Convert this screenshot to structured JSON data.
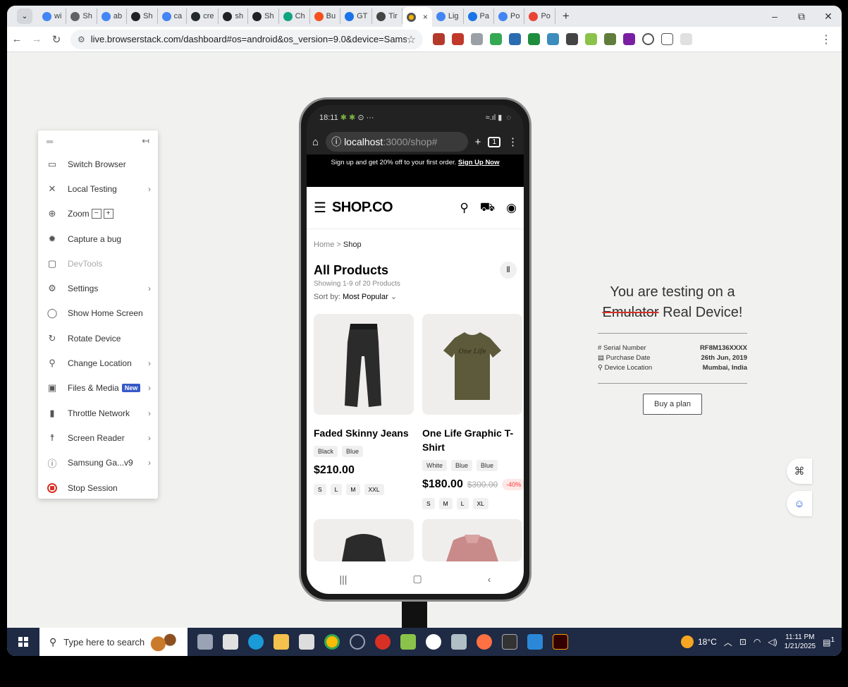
{
  "browser": {
    "tabs": [
      {
        "label": "wi",
        "icon": "google-icon",
        "color": "#4285f4"
      },
      {
        "label": "Sh",
        "icon": "chrome-icon",
        "color": "#5f6368"
      },
      {
        "label": "ab",
        "icon": "google-icon",
        "color": "#4285f4"
      },
      {
        "label": "Sh",
        "icon": "app-icon",
        "color": "#202124"
      },
      {
        "label": "ca",
        "icon": "google-icon",
        "color": "#4285f4"
      },
      {
        "label": "cre",
        "icon": "github-icon",
        "color": "#24292e"
      },
      {
        "label": "sh",
        "icon": "app-icon",
        "color": "#202124"
      },
      {
        "label": "Sh",
        "icon": "app-icon",
        "color": "#202124"
      },
      {
        "label": "Ch",
        "icon": "openai-icon",
        "color": "#10a37f"
      },
      {
        "label": "Bu",
        "icon": "bookmark-icon",
        "color": "#f4511e"
      },
      {
        "label": "GT",
        "icon": "gt-icon",
        "color": "#1a73e8"
      },
      {
        "label": "Tir",
        "icon": "tinder-icon",
        "color": "#444"
      }
    ],
    "active_tab": {
      "label": "",
      "close": "×"
    },
    "tabs_after": [
      {
        "label": "Lig",
        "icon": "google-icon",
        "color": "#4285f4"
      },
      {
        "label": "Pa",
        "icon": "gauge-icon",
        "color": "#1a73e8"
      },
      {
        "label": "Po",
        "icon": "google-icon",
        "color": "#4285f4"
      },
      {
        "label": "Po",
        "icon": "app-icon",
        "color": "#ea4335"
      }
    ],
    "new_tab": "+",
    "url": "live.browserstack.com/dashboard#os=android&os_version=9.0&device=Samsun...",
    "zoom_label": "≡"
  },
  "panel": {
    "items": [
      {
        "label": "Switch Browser",
        "icon": "switch-browser-icon",
        "glyph": "▭",
        "chevron": false
      },
      {
        "label": "Local Testing",
        "icon": "local-testing-icon",
        "glyph": "✕",
        "chevron": true
      },
      {
        "label": "Zoom",
        "icon": "zoom-icon",
        "glyph": "⊕",
        "chevron": false
      },
      {
        "label": "Capture a bug",
        "icon": "bug-icon",
        "glyph": "✹",
        "chevron": false
      },
      {
        "label": "DevTools",
        "icon": "devtools-icon",
        "glyph": "▢",
        "chevron": false
      },
      {
        "label": "Settings",
        "icon": "settings-icon",
        "glyph": "⚙",
        "chevron": true
      },
      {
        "label": "Show Home Screen",
        "icon": "home-screen-icon",
        "glyph": "◯",
        "chevron": false
      },
      {
        "label": "Rotate Device",
        "icon": "rotate-icon",
        "glyph": "↻",
        "chevron": false
      },
      {
        "label": "Change Location",
        "icon": "location-icon",
        "glyph": "⚲",
        "chevron": true
      },
      {
        "label": "Files & Media",
        "icon": "files-media-icon",
        "glyph": "▣",
        "chevron": true
      },
      {
        "label": "Throttle Network",
        "icon": "network-icon",
        "glyph": "▮",
        "chevron": true
      },
      {
        "label": "Screen Reader",
        "icon": "accessibility-icon",
        "glyph": "☨",
        "chevron": true
      },
      {
        "label": "Samsung Ga...v9",
        "icon": "info-icon",
        "glyph": "ⓘ",
        "chevron": true
      },
      {
        "label": "Stop Session",
        "icon": "stop-icon",
        "glyph": "",
        "chevron": false
      }
    ],
    "zoom_minus": "−",
    "zoom_plus": "+",
    "new_badge": "New"
  },
  "phone": {
    "time": "18:11",
    "url_host": "localhost",
    "url_rest": ":3000/shop#",
    "tab_count": "1",
    "promo_text": "Sign up and get 20% off to your first order.",
    "promo_link": "Sign Up Now",
    "logo": "SHOP.CO",
    "breadcrumb_home": "Home",
    "breadcrumb_sep": ">",
    "breadcrumb_current": "Shop",
    "heading": "All Products",
    "showing": "Showing 1-9 of 20 Products",
    "sort_label": "Sort by:",
    "sort_value": "Most Popular",
    "products": [
      {
        "name": "Faded Skinny Jeans",
        "colors": [
          "Black",
          "Blue"
        ],
        "price": "$210.00",
        "old_price": "",
        "discount": "",
        "sizes": [
          "S",
          "L",
          "M",
          "XXL"
        ]
      },
      {
        "name": "One Life Graphic T-Shirt",
        "colors": [
          "White",
          "Blue",
          "Blue"
        ],
        "price": "$180.00",
        "old_price": "$300.00",
        "discount": "-40%",
        "sizes": [
          "S",
          "M",
          "L",
          "XL"
        ]
      }
    ]
  },
  "info": {
    "title_line1": "You are testing on a",
    "title_strike": "Emulator",
    "title_rest": "Real Device!",
    "serial_label": "Serial Number",
    "serial_value": "RF8M136XXXX",
    "purchase_label": "Purchase Date",
    "purchase_value": "26th Jun, 2019",
    "location_label": "Device Location",
    "location_value": "Mumbai, India",
    "buy_label": "Buy a plan"
  },
  "taskbar": {
    "search_placeholder": "Type here to search",
    "temperature": "18°C",
    "time": "11:11 PM",
    "date": "1/21/2025",
    "notif_count": "1"
  },
  "colors": {
    "accent": "#3659c6",
    "stop": "#d93025",
    "taskbar": "#1f2a44"
  }
}
